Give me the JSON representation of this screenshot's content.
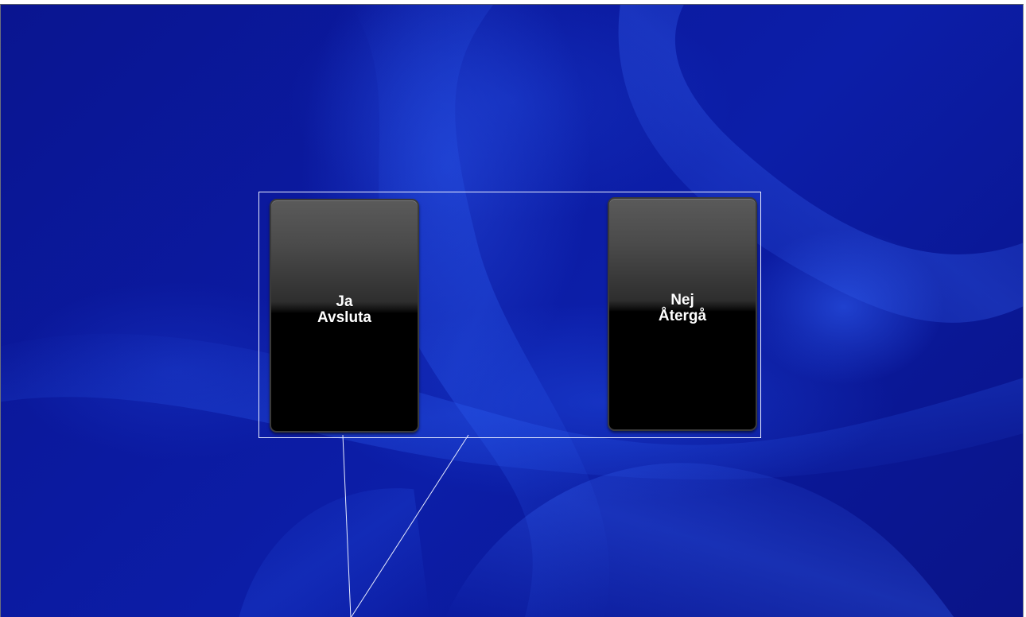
{
  "dialog": {
    "confirm_button": {
      "line1": "Ja",
      "line2": "Avsluta"
    },
    "cancel_button": {
      "line1": "Nej",
      "line2": "Återgå"
    }
  },
  "colors": {
    "background": "#0b1aa0",
    "frame": "#e8ecff",
    "button_fill": "#000000",
    "button_text": "#ffffff"
  }
}
